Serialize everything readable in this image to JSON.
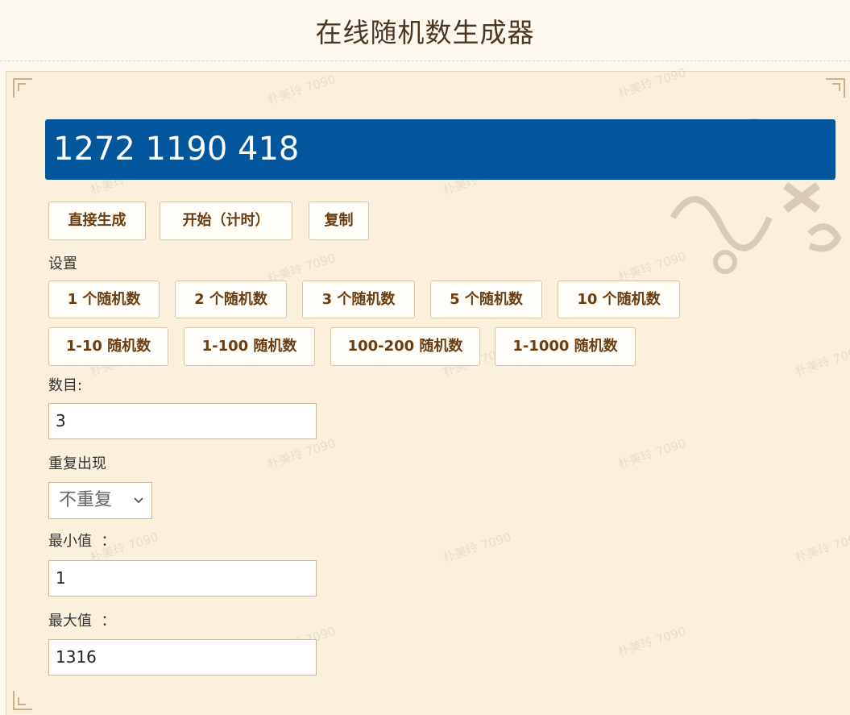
{
  "header": {
    "title": "在线随机数生成器"
  },
  "result": {
    "value": "1272 1190 418"
  },
  "actions": {
    "generate": "直接生成",
    "start_timer": "开始（计时）",
    "copy": "复制"
  },
  "settings": {
    "label": "设置",
    "count_presets": [
      "1 个随机数",
      "2 个随机数",
      "3 个随机数",
      "5 个随机数",
      "10 个随机数"
    ],
    "range_presets": [
      "1-10 随机数",
      "1-100 随机数",
      "100-200 随机数",
      "1-1000 随机数"
    ]
  },
  "form": {
    "count_label": "数目:",
    "count_value": "3",
    "repeat_label": "重复出现",
    "repeat_value": "不重复",
    "min_label": "最小值  ：",
    "min_value": "1",
    "max_label": "最大值  ：",
    "max_value": "1316"
  },
  "watermark": {
    "text": "朴美玲 7090"
  },
  "icons": {
    "select_arrow": "chevron-down-icon",
    "corner_ornament": "corner-ornament-icon",
    "math_decoration": "math-symbols-decoration"
  }
}
